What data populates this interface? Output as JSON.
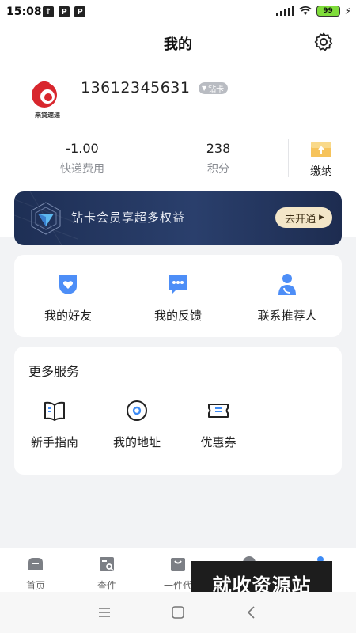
{
  "status_bar": {
    "time": "15:08",
    "left_icons": [
      "↑",
      "P",
      "P"
    ],
    "battery_text": "99"
  },
  "header": {
    "title": "我的"
  },
  "profile": {
    "phone": "13612345631",
    "tier_badge": "钻卡",
    "avatar_caption": "来贷速递"
  },
  "stats": [
    {
      "value": "-1.00",
      "label": "快递费用"
    },
    {
      "value": "238",
      "label": "积分"
    }
  ],
  "pay": {
    "label": "缴纳"
  },
  "vip_banner": {
    "text": "钻卡会员享超多权益",
    "button": "去开通"
  },
  "quick_actions": [
    {
      "label": "我的好友",
      "icon": "heart-shield-icon"
    },
    {
      "label": "我的反馈",
      "icon": "chat-bubble-icon"
    },
    {
      "label": "联系推荐人",
      "icon": "contact-person-icon"
    }
  ],
  "more_services": {
    "title": "更多服务",
    "items": [
      {
        "label": "新手指南",
        "icon": "book-icon"
      },
      {
        "label": "我的地址",
        "icon": "location-icon"
      },
      {
        "label": "优惠券",
        "icon": "coupon-icon"
      }
    ]
  },
  "tab_bar": {
    "items": [
      "首页",
      "查件",
      "一件代"
    ]
  },
  "watermark": "就收资源站",
  "colors": {
    "accent_blue": "#3d8bf5",
    "vip_gold": "#f3e6c8",
    "banner_navy": "#1e2f55"
  }
}
